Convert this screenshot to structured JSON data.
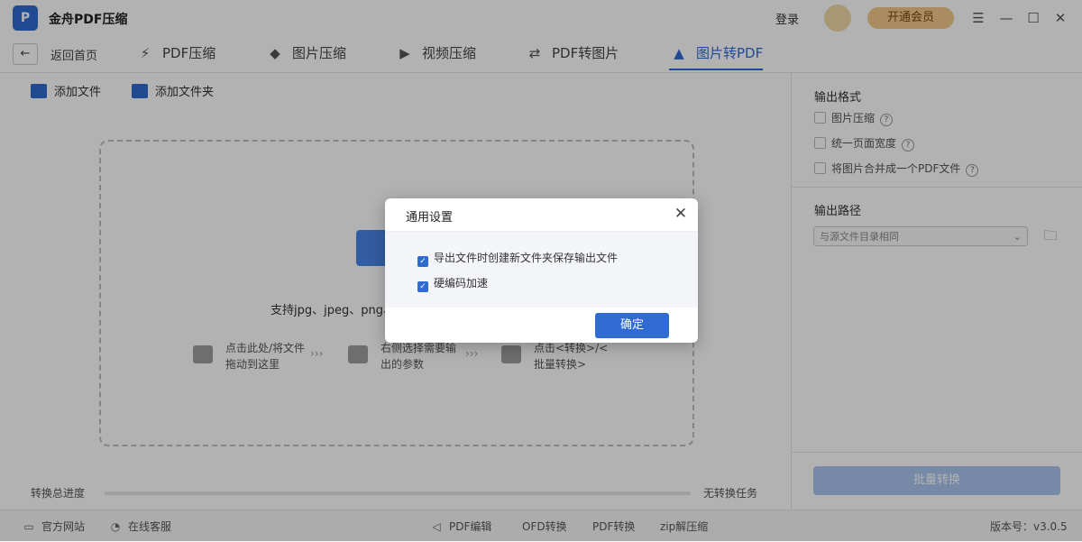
{
  "app": {
    "title": "金舟PDF压缩",
    "logo_icon": "app-logo-icon"
  },
  "titlebar": {
    "login": "登录",
    "vip": "开通会员",
    "menu_icon": "☰",
    "minimize_icon": "—",
    "maximize_icon": "☐",
    "close_icon": "✕"
  },
  "nav": {
    "back_icon": "←",
    "home": "返回首页",
    "tabs": [
      {
        "label": "PDF压缩",
        "icon": "⚡"
      },
      {
        "label": "图片压缩",
        "icon": "◆"
      },
      {
        "label": "视频压缩",
        "icon": "▶"
      },
      {
        "label": "PDF转图片",
        "icon": "⇄"
      },
      {
        "label": "图片转PDF",
        "icon": "▲",
        "active": true
      }
    ]
  },
  "toolbar": {
    "add_file": "添加文件",
    "add_folder": "添加文件夹"
  },
  "dropzone": {
    "support_text": "支持jpg、jpeg、png、",
    "step1": "点击此处/将文件拖动到这里",
    "step2": "右侧选择需要输出的参数",
    "step3": "点击<转换>/<批量转换>",
    "arrow": "›››"
  },
  "sidebar": {
    "output_format": "输出格式",
    "options": [
      {
        "label": "图片压缩",
        "help": "?"
      },
      {
        "label": "统一页面宽度",
        "help": "?"
      },
      {
        "label": "将图片合并成一个PDF文件",
        "help": "?"
      }
    ],
    "output_path": "输出路径",
    "path_value": "与源文件目录相同",
    "chevron": "⌄",
    "folder_icon": "🗀",
    "batch_convert": "批量转换"
  },
  "progress": {
    "label": "转换总进度",
    "status": "无转换任务",
    "value": 0
  },
  "footer": {
    "website": "官方网站",
    "service": "在线客服",
    "pdf_edit": "PDF编辑",
    "ofd": "OFD转换",
    "pdf_convert": "PDF转换",
    "zip": "zip解压缩",
    "version": "版本号：v3.0.5"
  },
  "dialog": {
    "title": "通用设置",
    "close": "✕",
    "opt1": "导出文件时创建新文件夹保存输出文件",
    "opt2": "硬编码加速",
    "check": "✓",
    "confirm": "确定"
  },
  "colors": {
    "accent": "#2f6bd1",
    "vip": "#f2c98a",
    "overlay": "rgba(0,0,0,0.3)"
  }
}
